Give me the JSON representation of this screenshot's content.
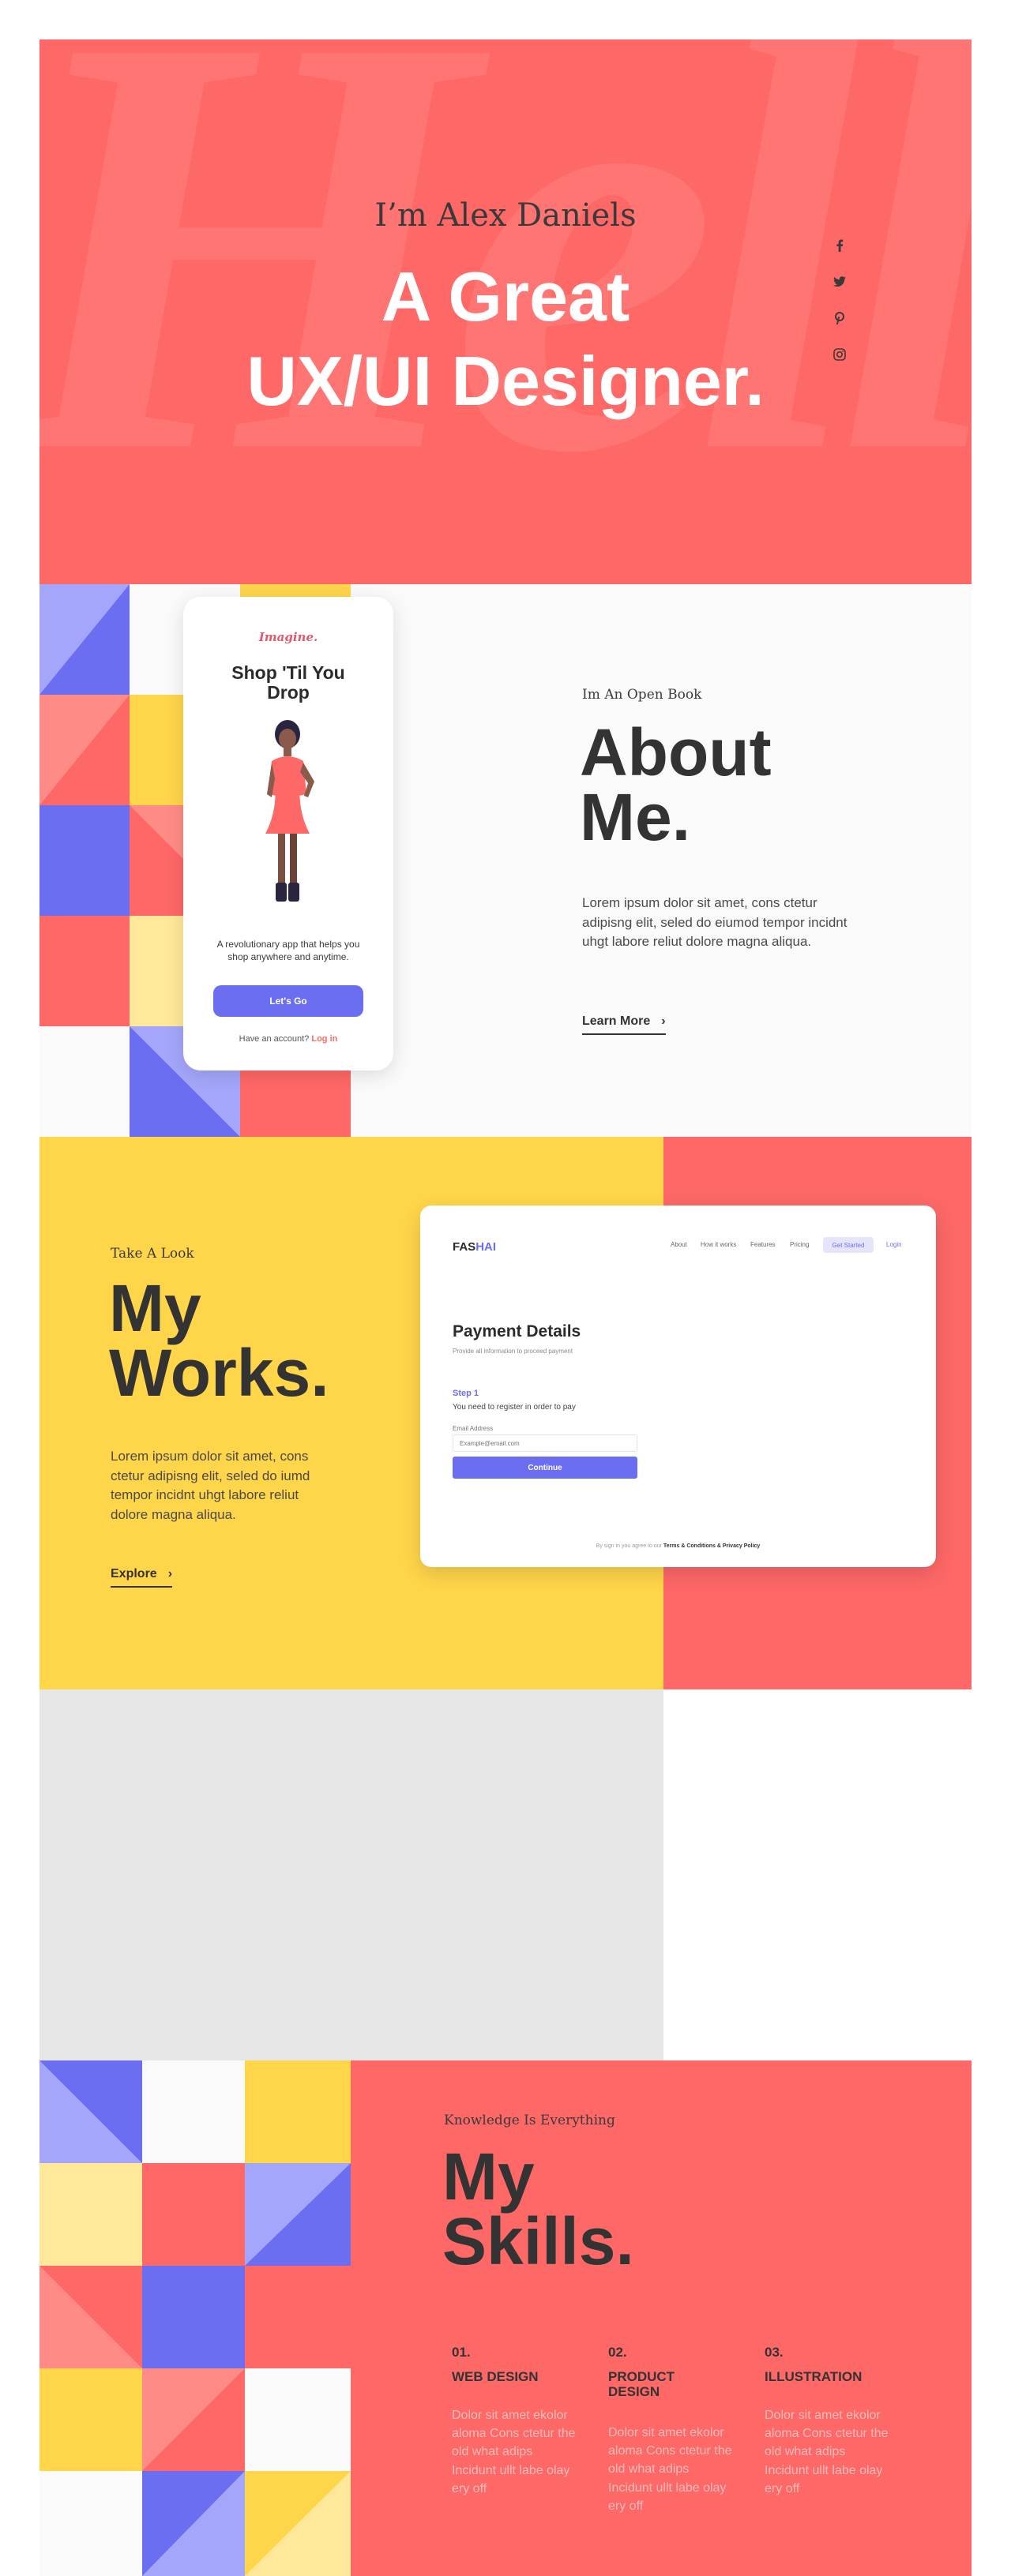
{
  "hero": {
    "background_word": "Hello",
    "intro": "I’m Alex Daniels",
    "headline_line1": "A Great",
    "headline_line2": "UX/UI Designer.",
    "social": [
      {
        "name": "facebook-icon",
        "glyph": "f"
      },
      {
        "name": "twitter-icon",
        "glyph": "🐦"
      },
      {
        "name": "pinterest-icon",
        "glyph": "P"
      },
      {
        "name": "instagram-icon",
        "glyph": "◎"
      }
    ]
  },
  "about": {
    "kicker": "Im An Open Book",
    "title_line1": "About",
    "title_line2": "Me.",
    "description": "Lorem ipsum dolor sit amet, cons ctetur adipisng elit, seled do eiumod tempor incidnt uhgt labore reliut dolore magna aliqua.",
    "link_label": "Learn More",
    "phone": {
      "brand": "Imagine.",
      "title": "Shop 'Til You Drop",
      "description": "A revolutionary app that helps you shop anywhere and anytime.",
      "button_label": "Let's Go",
      "footer_text": "Have an account?",
      "footer_link": "Log in"
    }
  },
  "works": {
    "kicker": "Take A Look",
    "title_line1": "My",
    "title_line2": "Works.",
    "description": "Lorem ipsum dolor sit amet, cons ctetur adipisng elit, seled do iumd tempor incidnt uhgt labore reliut dolore magna aliqua.",
    "link_label": "Explore",
    "card": {
      "logo_a": "FAS",
      "logo_b": "HAI",
      "nav": [
        "About",
        "How it works",
        "Features",
        "Pricing"
      ],
      "get_started": "Get Started",
      "login": "Login",
      "title": "Payment Details",
      "subtitle": "Provide all information to proceed payment",
      "step": "Step 1",
      "step_desc": "You need to register in order to pay",
      "email_label": "Email Address",
      "email_placeholder": "Example@email.com",
      "button_label": "Continue",
      "terms_prefix": "By sign in you agree to our",
      "terms_link": "Terms & Conditions & Privacy Policy"
    }
  },
  "skills": {
    "kicker": "Knowledge Is Everything",
    "title_line1": "My",
    "title_line2": "Skills.",
    "items": [
      {
        "num": "01.",
        "title": "WEB DESIGN",
        "desc": "Dolor sit amet ekolor aloma Cons ctetur the old what adips Incidunt ullt labe olay ery off"
      },
      {
        "num": "02.",
        "title": "PRODUCT DESIGN",
        "desc": "Dolor sit amet ekolor aloma Cons ctetur the old what adips Incidunt ullt labe olay ery off"
      },
      {
        "num": "03.",
        "title": "ILLUSTRATION",
        "desc": "Dolor sit amet ekolor aloma Cons ctetur the old what adips Incidunt ullt labe olay ery off"
      }
    ]
  },
  "colors": {
    "coral": "#fe6867",
    "yellow": "#ffd54a",
    "light_yellow": "#ffe89a",
    "purple": "#6c6ef2",
    "light_purple": "#a4a6fb",
    "dark_text": "#333333",
    "grey_block": "#e6e6e6"
  }
}
